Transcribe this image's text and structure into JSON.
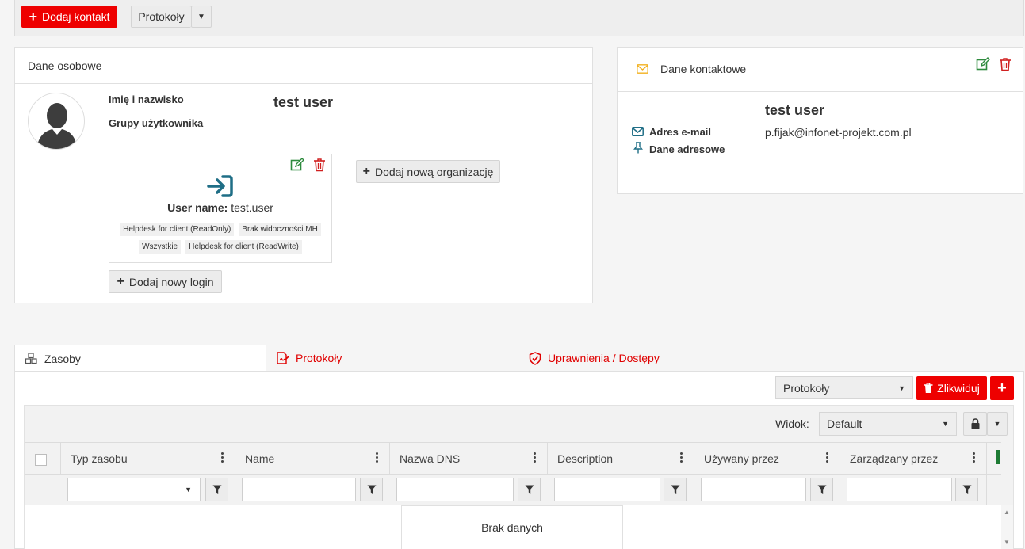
{
  "toolbar": {
    "add_contact_label": "Dodaj kontakt",
    "protocols_label": "Protokoły"
  },
  "personal": {
    "header": "Dane osobowe",
    "full_name_label": "Imię i nazwisko",
    "full_name_value": "test user",
    "groups_label": "Grupy użytkownika",
    "login_card": {
      "username_label": "User name:",
      "username_value": "test.user",
      "tags": [
        "Helpdesk for client (ReadOnly)",
        "Brak widoczności MH",
        "Wszystkie",
        "Helpdesk for client (ReadWrite)"
      ]
    },
    "add_org_label": "Dodaj nową organizację",
    "add_login_label": "Dodaj nowy login"
  },
  "contact": {
    "header": "Dane kontaktowe",
    "name": "test user",
    "email_label": "Adres e-mail",
    "email_value": "p.fijak@infonet-projekt.com.pl",
    "address_label": "Dane adresowe"
  },
  "tabs": [
    {
      "label": "Zasoby"
    },
    {
      "label": "Protokoły"
    },
    {
      "label": "Uprawnienia / Dostępy"
    }
  ],
  "content": {
    "protocols_select": "Protokoły",
    "liquidate_label": "Zlikwiduj",
    "view_label": "Widok:",
    "view_value": "Default",
    "columns": [
      "Typ zasobu",
      "Name",
      "Nazwa DNS",
      "Description",
      "Używany przez",
      "Zarządzany przez"
    ],
    "empty_text": "Brak danych"
  },
  "colors": {
    "accent_red": "#ee0000",
    "edit_green": "#2e8b3e",
    "teal_icon": "#1f6e86",
    "mail_yellow": "#f2b01e"
  }
}
